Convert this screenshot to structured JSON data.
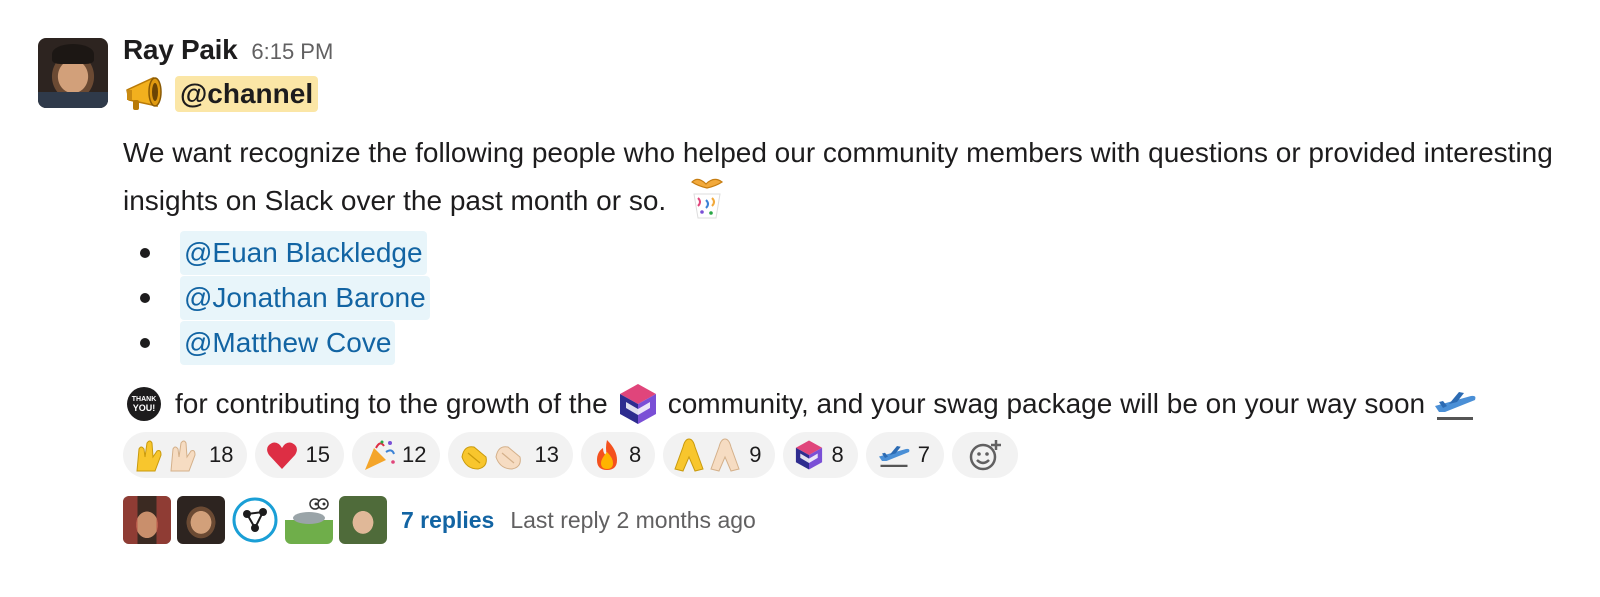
{
  "message": {
    "sender": "Ray Paik",
    "timestamp": "6:15 PM",
    "channel_mention": "@channel",
    "body": "We want recognize the following people who helped our community members with questions or provided interesting insights on Slack over the past month or so.",
    "mentions": [
      {
        "label": "@Euan Blackledge"
      },
      {
        "label": "@Jonathan Barone"
      },
      {
        "label": "@Matthew Cove"
      }
    ],
    "thanks_pre": "for contributing to the growth of the",
    "thanks_post": "community, and your swag package will be on your way soon",
    "thanks_badge_text": "THANK YOU!"
  },
  "reactions": [
    {
      "icon": "raised-hands-icon",
      "count": "18"
    },
    {
      "icon": "red-heart-icon",
      "count": "15"
    },
    {
      "icon": "party-popper-icon",
      "count": "12"
    },
    {
      "icon": "clapping-hands-icon",
      "count": "13"
    },
    {
      "icon": "fire-icon",
      "count": "8"
    },
    {
      "icon": "folded-hands-icon",
      "count": "9"
    },
    {
      "icon": "community-logo-icon",
      "count": "8"
    },
    {
      "icon": "airplane-icon",
      "count": "7"
    }
  ],
  "thread": {
    "replies": "7 replies",
    "last_reply": "Last reply 2 months ago"
  },
  "colors": {
    "mention_bg": "#e8f5fa",
    "mention_text": "#1264a3",
    "channel_bg": "#fbe6a6",
    "reaction_bg": "#f2f2f2",
    "muted_text": "#616061"
  }
}
